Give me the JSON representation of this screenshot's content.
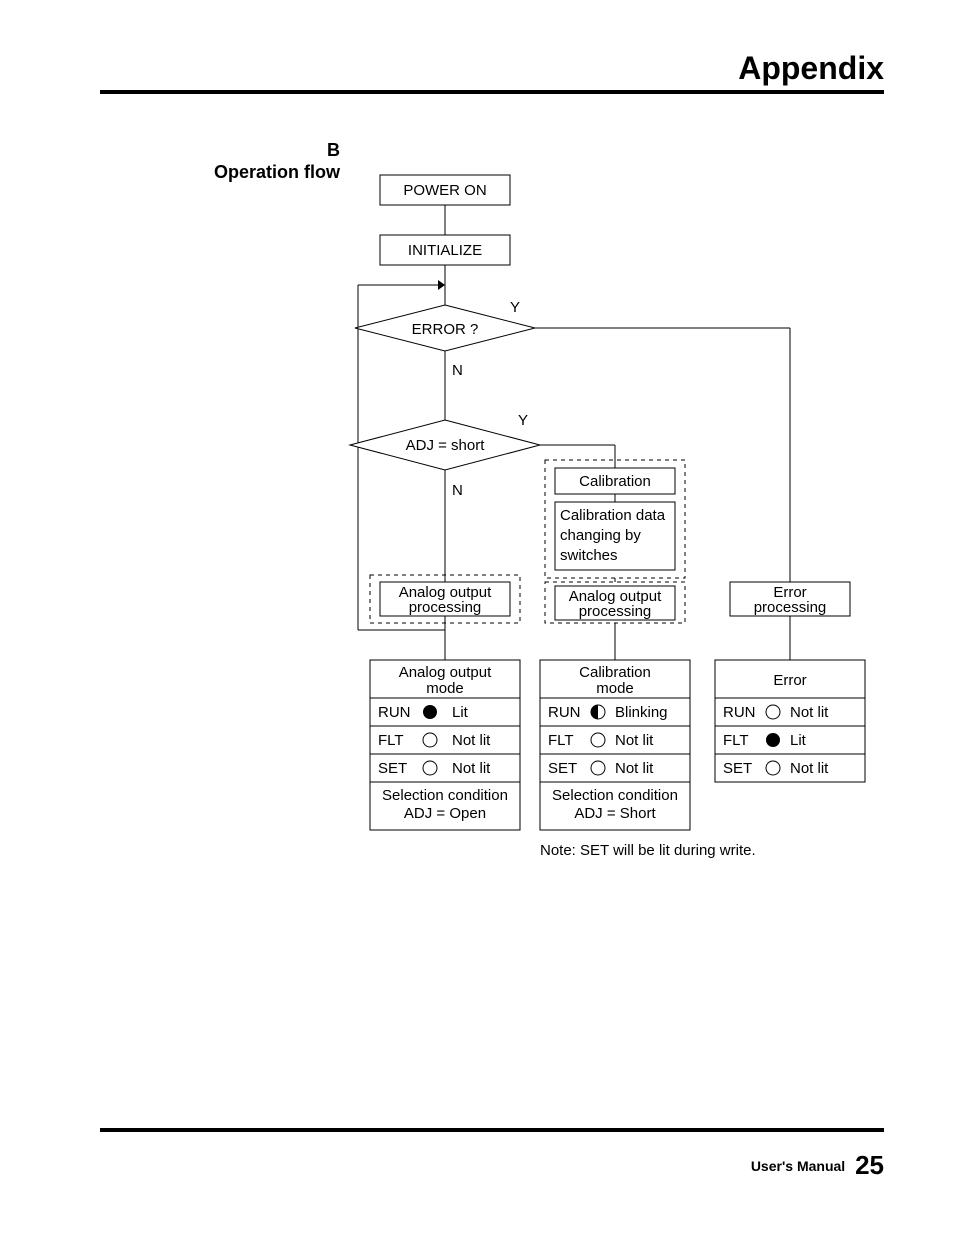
{
  "header": {
    "title": "Appendix"
  },
  "section": {
    "letter": "B",
    "title": "Operation flow"
  },
  "flow": {
    "power_on": "POWER ON",
    "initialize": "INITIALIZE",
    "error_q": "ERROR ?",
    "adj_short": "ADJ = short",
    "y1": "Y",
    "n1": "N",
    "y2": "Y",
    "n2": "N",
    "calibration": "Calibration",
    "calib_change_l1": "Calibration data",
    "calib_change_l2": "changing by",
    "calib_change_l3": "switches",
    "analog_out_l1": "Analog output",
    "analog_out_l2": "processing",
    "error_proc_l1": "Error",
    "error_proc_l2": "processing"
  },
  "legend": {
    "col1": {
      "title_l1": "Analog output",
      "title_l2": "mode",
      "run": "RUN",
      "run_state": "Lit",
      "flt": "FLT",
      "flt_state": "Not lit",
      "set": "SET",
      "set_state": "Not lit",
      "cond_l1": "Selection condition",
      "cond_l2": "ADJ = Open"
    },
    "col2": {
      "title_l1": "Calibration",
      "title_l2": "mode",
      "run": "RUN",
      "run_state": "Blinking",
      "flt": "FLT",
      "flt_state": "Not lit",
      "set": "SET",
      "set_state": "Not lit",
      "cond_l1": "Selection condition",
      "cond_l2": "ADJ = Short"
    },
    "col3": {
      "title": "Error",
      "run": "RUN",
      "run_state": "Not lit",
      "flt": "FLT",
      "flt_state": "Lit",
      "set": "SET",
      "set_state": "Not lit"
    }
  },
  "note": "Note: SET will be lit during write.",
  "footer": {
    "label": "User's Manual",
    "page": "25"
  }
}
